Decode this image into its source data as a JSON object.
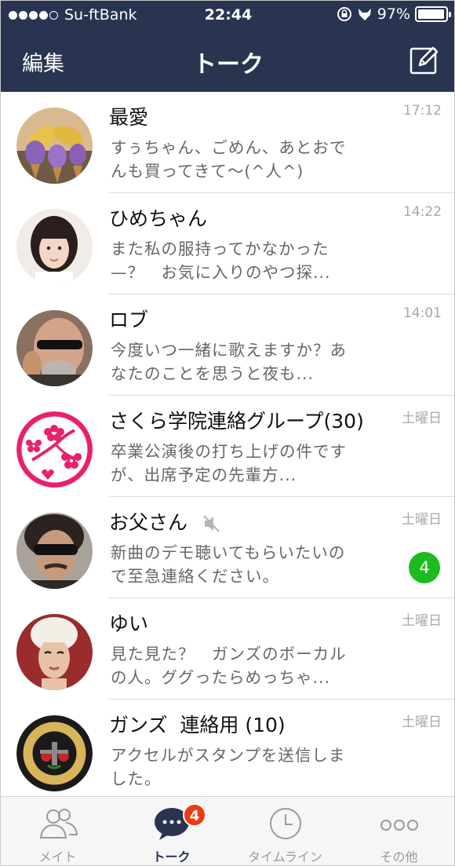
{
  "status_bar": {
    "carrier": "Su-ftBank",
    "time": "22:44",
    "battery_percent": "97%",
    "battery_level": 0.97,
    "signal_icons": [
      "signal-dot-full",
      "signal-dot-full",
      "signal-dot-full",
      "signal-dot-full",
      "signal-dot-empty"
    ]
  },
  "nav": {
    "edit_label": "編集",
    "title": "トーク",
    "compose_icon": "compose-icon"
  },
  "colors": {
    "header_bg": "#283450",
    "unread_badge": "#1dbb1d",
    "tab_badge": "#ee3a12"
  },
  "chats": [
    {
      "name": "最愛",
      "preview": "すぅちゃん、ごめん、あとおでんも買ってきて〜(^人^)",
      "time": "17:12",
      "unread": "",
      "muted": false,
      "avatar": "sweet-potato-icecream-avatar"
    },
    {
      "name": "ひめちゃん",
      "preview": "また私の服持ってかなかった—？　お気に入りのやつ探...",
      "time": "14:22",
      "unread": "",
      "muted": false,
      "avatar": "girl-portrait-avatar"
    },
    {
      "name": "ロブ",
      "preview": "今度いつ一緒に歌えますか？あなたのことを思うと夜も...",
      "time": "14:01",
      "unread": "",
      "muted": false,
      "avatar": "bald-man-sunglasses-avatar"
    },
    {
      "name": "さくら学院連絡グループ(30)",
      "preview": "卒業公演後の打ち上げの件ですが、出席予定の先輩方...",
      "time": "土曜日",
      "unread": "",
      "muted": false,
      "avatar": "sakura-logo-avatar"
    },
    {
      "name": "お父さん",
      "preview": "新曲のデモ聴いてもらいたいので至急連絡ください。",
      "time": "土曜日",
      "unread": "4",
      "muted": true,
      "avatar": "man-sunglasses-avatar"
    },
    {
      "name": "ゆい",
      "preview": "見た見た？　ガンズのボーカルの人。ググったらめっちゃ...",
      "time": "土曜日",
      "unread": "",
      "muted": false,
      "avatar": "girl-towel-avatar"
    },
    {
      "name": "ガンズ  連絡用 (10)",
      "preview": "アクセルがスタンプを送信しました。",
      "time": "土曜日",
      "unread": "",
      "muted": false,
      "avatar": "band-logo-avatar"
    }
  ],
  "tabs": [
    {
      "label": "メイト",
      "icon": "friends-icon",
      "active": false,
      "badge": ""
    },
    {
      "label": "トーク",
      "icon": "chat-bubble-icon",
      "active": true,
      "badge": "4"
    },
    {
      "label": "タイムライン",
      "icon": "clock-icon",
      "active": false,
      "badge": ""
    },
    {
      "label": "その他",
      "icon": "more-icon",
      "active": false,
      "badge": ""
    }
  ]
}
